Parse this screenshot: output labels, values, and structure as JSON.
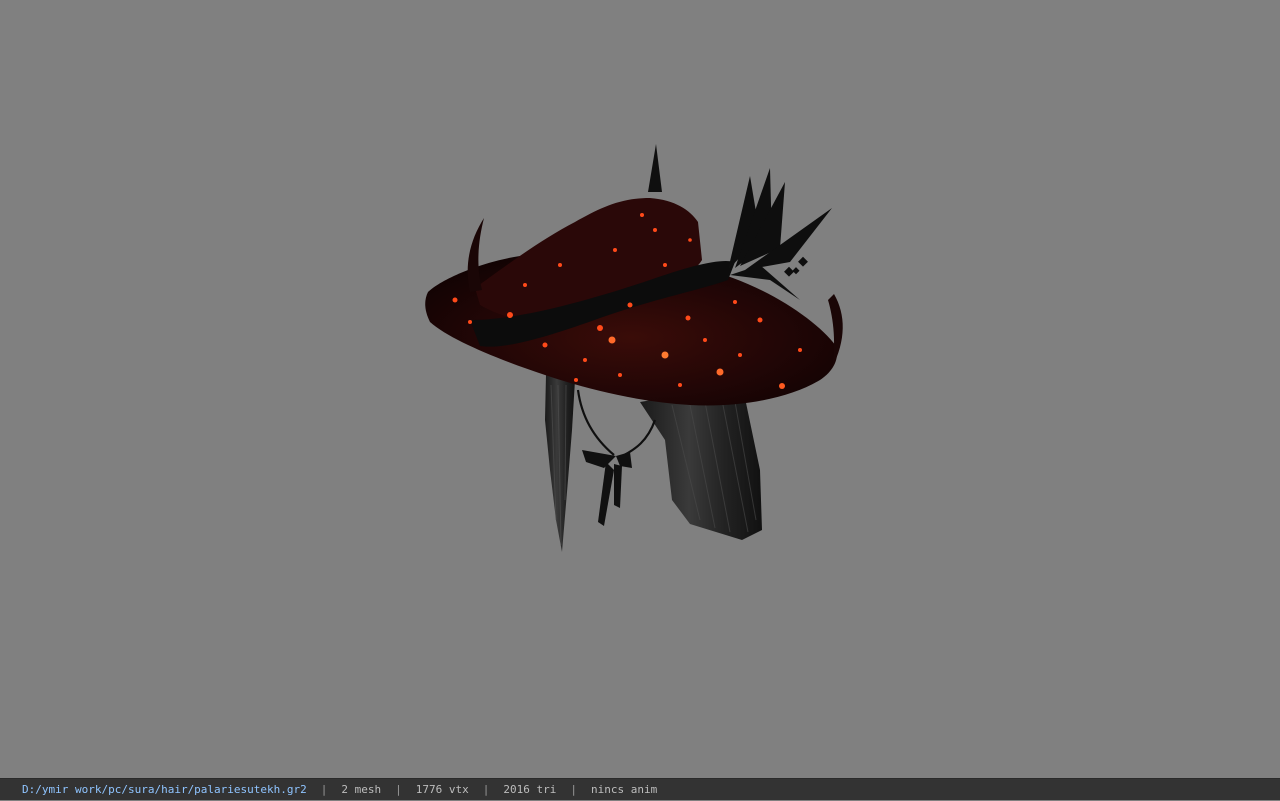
{
  "viewport": {
    "background_color": "#808080",
    "model": "hat-with-hair-model"
  },
  "status_bar": {
    "file_path": "D:/ymir work/pc/sura/hair/palariesutekh.gr2",
    "separator": "|",
    "mesh_count": "2 mesh",
    "vertex_count": "1776 vtx",
    "triangle_count": "2016 tri",
    "anim_status": "nincs anim",
    "path_color": "#8fc4ff",
    "text_color": "#bdbdbd",
    "background_color": "#333333"
  }
}
